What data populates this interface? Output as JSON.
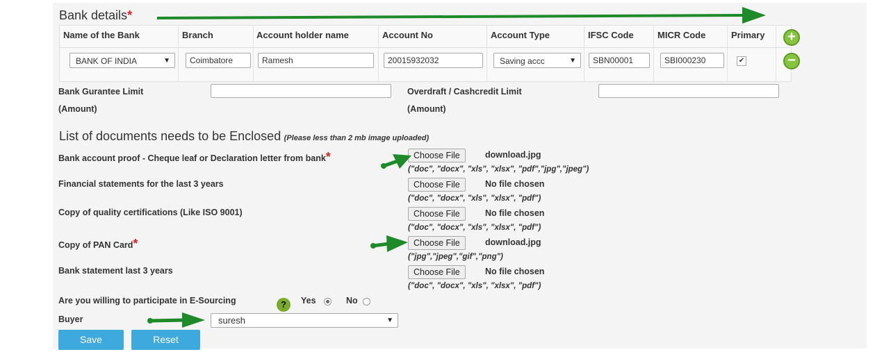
{
  "bank": {
    "title": "Bank details",
    "required_mark": "*",
    "columns": [
      "Name of the Bank",
      "Branch",
      "Account holder name",
      "Account No",
      "Account Type",
      "IFSC Code",
      "MICR Code",
      "Primary"
    ],
    "row": {
      "bank_name": "BANK OF INDIA",
      "branch": "Coimbatore",
      "holder": "Ramesh",
      "account_no": "20015932032",
      "account_type": "Saving accc",
      "ifsc": "SBN00001",
      "micr": "SBI000230",
      "primary_check": "✔"
    },
    "add_symbol": "+",
    "remove_symbol": "−"
  },
  "limits": {
    "guarantee_label_1": "Bank Gurantee Limit",
    "guarantee_label_2": "(Amount)",
    "overdraft_label_1": "Overdraft / Cashcredit Limit",
    "overdraft_label_2": "(Amount)"
  },
  "documents": {
    "title": "List of documents needs to be Enclosed",
    "note": "(Please less than 2 mb image uploaded)",
    "choose_label": "Choose File",
    "items": [
      {
        "label": "Bank account proof - Cheque leaf or Declaration letter from bank",
        "file": "download.jpg",
        "ext": "(\"doc\", \"docx\", \"xls\", \"xlsx\", \"pdf\",\"jpg\",\"jpeg\")"
      },
      {
        "label": "Financial statements for the last 3 years",
        "file": "No file chosen",
        "ext": "(\"doc\", \"docx\", \"xls\", \"xlsx\", \"pdf\")"
      },
      {
        "label": "Copy of quality certifications (Like ISO 9001)",
        "file": "No file chosen",
        "ext": "(\"doc\", \"docx\", \"xls\", \"xlsx\", \"pdf\")"
      },
      {
        "label": "Copy of PAN Card",
        "file": "download.jpg",
        "ext": "(\"jpg\",\"jpeg\",\"gif\",\"png\")"
      },
      {
        "label": "Bank statement last 3 years",
        "file": "No file chosen",
        "ext": "(\"doc\", \"docx\", \"xls\", \"xlsx\", \"pdf\")"
      }
    ]
  },
  "esourcing": {
    "question": "Are you willing to participate in E-Sourcing",
    "help": "?",
    "yes": "Yes",
    "no": "No"
  },
  "buyer": {
    "label": "Buyer",
    "value": "suresh"
  },
  "actions": {
    "save": "Save",
    "reset": "Reset"
  },
  "colors": {
    "arrow": "#1f8a2a",
    "button": "#3ea9dc",
    "required": "#d22222"
  },
  "icons": [
    "plus-circle-icon",
    "minus-circle-icon",
    "help-icon",
    "dropdown-arrow-icon",
    "checkbox-icon"
  ],
  "symbols": {
    "arrow_down": "▼"
  }
}
